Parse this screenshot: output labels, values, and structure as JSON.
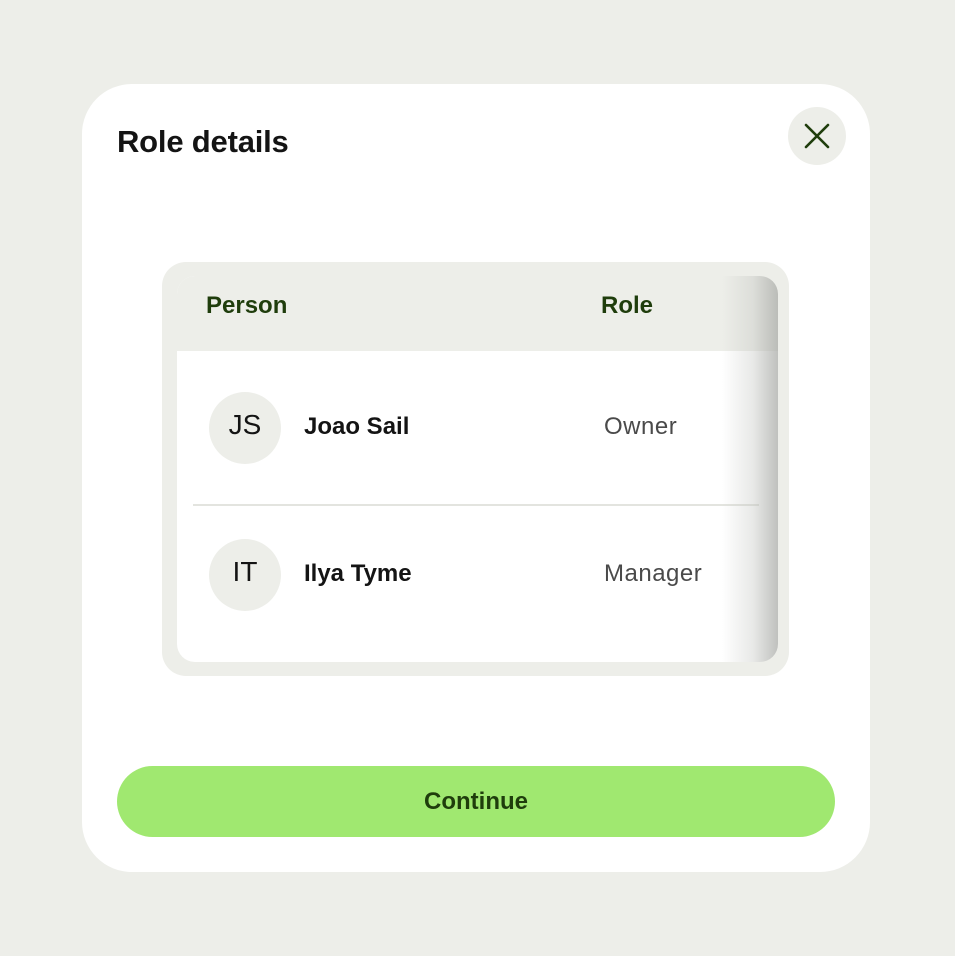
{
  "dialog": {
    "title": "Role details",
    "close_icon": "close-icon"
  },
  "table": {
    "columns": [
      "Person",
      "Role"
    ],
    "rows": [
      {
        "initials": "JS",
        "name": "Joao Sail",
        "role": "Owner"
      },
      {
        "initials": "IT",
        "name": "Ilya Tyme",
        "role": "Manager"
      }
    ]
  },
  "actions": {
    "continue_label": "Continue"
  },
  "colors": {
    "background": "#edeee9",
    "surface": "#ffffff",
    "accent": "#a0e870",
    "accent_text": "#1f3d0c",
    "text_primary": "#141414",
    "text_secondary": "#4a4a4a"
  }
}
